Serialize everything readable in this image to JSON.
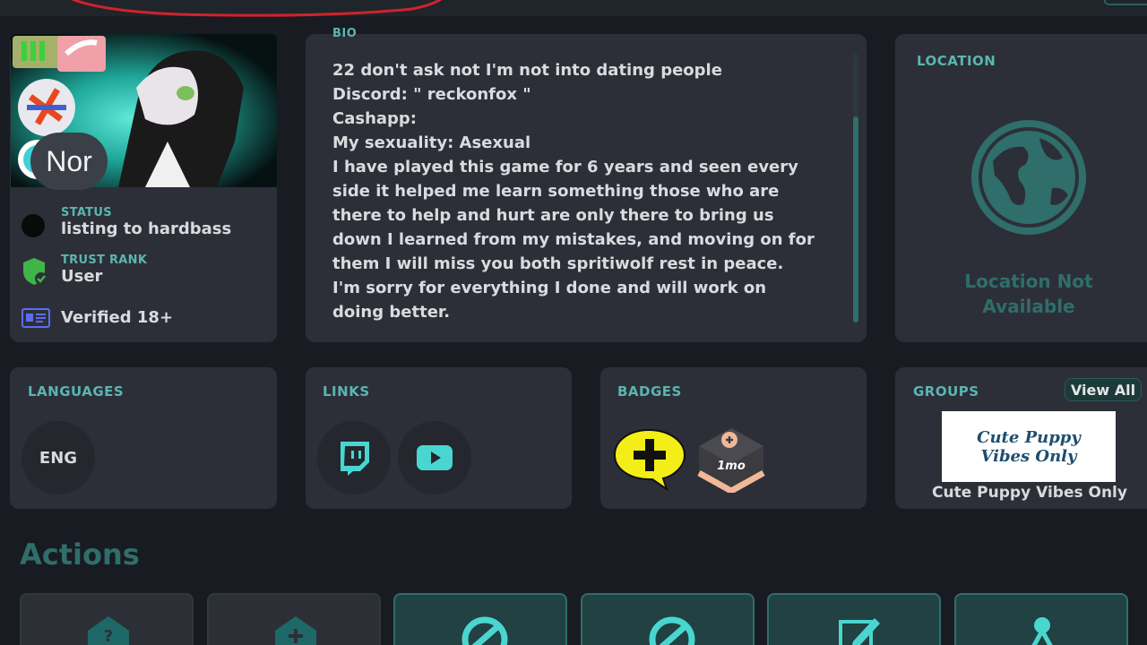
{
  "profile": {
    "avatar_initials": "Nor",
    "status_label": "STATUS",
    "status_value": "listing to hardbass",
    "trust_label": "TRUST RANK",
    "trust_value": "User",
    "verified": "Verified 18+"
  },
  "bio": {
    "label": "BIO",
    "text": "22 don't ask not I'm not into dating people\nDiscord: \" reckonfox \"\nCashapp:\nMy sexuality: Asexual\nI have played this game for 6 years and seen every\nside it helped me learn something those who are\nthere to help and hurt are only there to bring us\ndown I learned from my mistakes, and moving on for\nthem I will miss you both spritiwolf rest in peace.\nI'm sorry for everything I done and will work on\ndoing better."
  },
  "location": {
    "label": "LOCATION",
    "text": "Location Not\nAvailable"
  },
  "languages": {
    "label": "LANGUAGES",
    "items": [
      "ENG"
    ]
  },
  "links": {
    "label": "LINKS",
    "items": [
      "twitch-icon",
      "youtube-icon"
    ]
  },
  "badges": {
    "label": "BADGES",
    "one_month_text": "1mo"
  },
  "groups": {
    "label": "GROUPS",
    "view_all": "View All",
    "card_text": "Cute Puppy\nVibes Only",
    "name": "Cute Puppy Vibes Only"
  },
  "actions": {
    "title": "Actions"
  },
  "colors": {
    "accent": "#5bb5b1",
    "panel": "#2c2f37",
    "background": "#181b21",
    "teal_button": "#214142"
  }
}
